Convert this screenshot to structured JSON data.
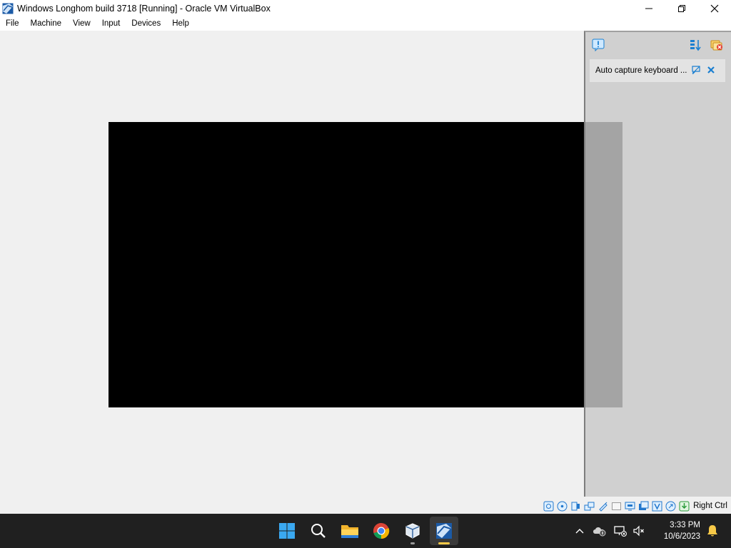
{
  "window": {
    "title": "Windows Longhom build 3718 [Running] - Oracle VM VirtualBox"
  },
  "menu": {
    "items": [
      {
        "label": "File"
      },
      {
        "label": "Machine"
      },
      {
        "label": "View"
      },
      {
        "label": "Input"
      },
      {
        "label": "Devices"
      },
      {
        "label": "Help"
      }
    ]
  },
  "notification_center": {
    "message": "Auto capture keyboard ...",
    "icons": [
      "alert-icon",
      "sort-icon",
      "close-all-icon",
      "keep-icon",
      "dismiss-icon"
    ]
  },
  "statusbar": {
    "host_key": "Right Ctrl",
    "icons": [
      "hard-disk-icon",
      "optical-drive-icon",
      "audio-icon",
      "network-icon",
      "usb-icon",
      "shared-folders-icon",
      "display-icon",
      "video-capture-icon",
      "vm-icon",
      "mouse-integration-icon",
      "keyboard-icon"
    ]
  },
  "taskbar": {
    "apps": [
      "start-icon",
      "search-icon",
      "file-explorer-icon",
      "chrome-icon",
      "virtualbox-manager-icon",
      "virtualbox-vm-icon"
    ],
    "tray_icons": [
      "show-hidden-icons-chevron",
      "onedrive-icon",
      "network-icon",
      "volume-muted-icon",
      "notification-bell-icon"
    ],
    "time": "3:33 PM",
    "date": "10/6/2023"
  },
  "colors": {
    "taskbar_bg": "#202020",
    "vm_screen": "#000000",
    "workspace_bg": "#f0f0f0",
    "accent_yellow": "#f7c948"
  }
}
